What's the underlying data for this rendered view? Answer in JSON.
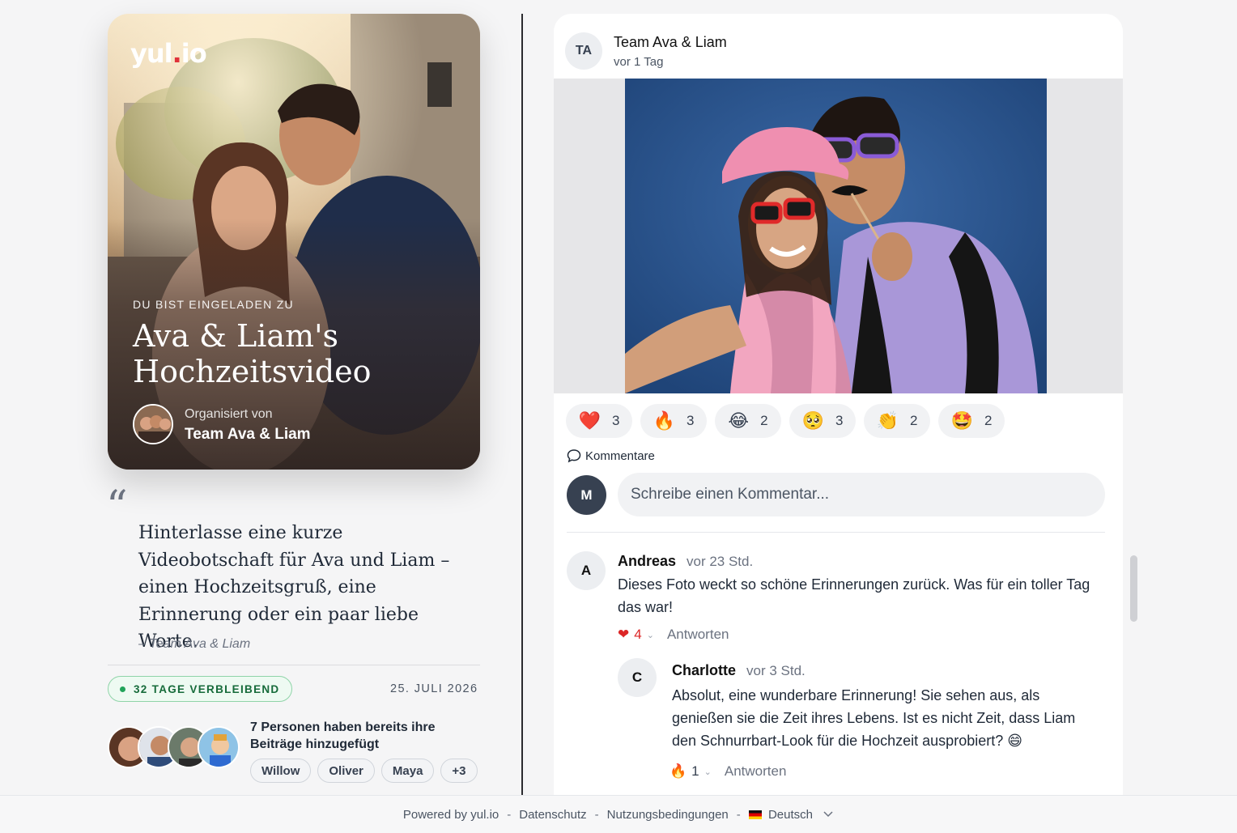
{
  "hero": {
    "logo_text": "yul",
    "logo_dot": ".",
    "logo_suffix": "io",
    "eyebrow": "DU BIST EINGELADEN ZU",
    "title_line1": "Ava & Liam's",
    "title_line2": "Hochzeitsvideo",
    "organizer_label": "Organisiert von",
    "organizer_name": "Team Ava & Liam"
  },
  "quote": {
    "mark": "“",
    "text": "Hinterlasse eine kurze Videobotschaft für Ava und Liam – einen Hochzeitsgruß, eine Erinnerung oder ein paar liebe Worte.",
    "signature": "– Team Ava & Liam"
  },
  "status": {
    "days_left": "32 TAGE VERBLEIBEND",
    "date": "25. JULI 2026",
    "status_color": "#22a35a"
  },
  "contributors": {
    "text": "7 Personen haben bereits ihre Beiträge hinzugefügt",
    "names": [
      "Willow",
      "Oliver",
      "Maya",
      "+3"
    ]
  },
  "post": {
    "author_initials": "TA",
    "author": "Team Ava & Liam",
    "time": "vor 1 Tag",
    "reactions": [
      {
        "icon": "heart-icon",
        "emoji": "❤️",
        "count": "3"
      },
      {
        "icon": "fire-icon",
        "emoji": "🔥",
        "count": "3"
      },
      {
        "icon": "laughing-icon",
        "emoji": "😂",
        "count": "2"
      },
      {
        "icon": "pleading-icon",
        "emoji": "🥺",
        "count": "3"
      },
      {
        "icon": "clapping-icon",
        "emoji": "👏",
        "count": "2"
      },
      {
        "icon": "star-struck-icon",
        "emoji": "🤩",
        "count": "2"
      }
    ],
    "comments_label": "Kommentare",
    "my_initial": "M",
    "comment_placeholder": "Schreibe einen Kommentar..."
  },
  "comments": [
    {
      "initial": "A",
      "name": "Andreas",
      "time": "vor 23 Std.",
      "text": "Dieses Foto weckt so schöne Erinnerungen zurück. Was für ein toller Tag das war!",
      "reaction_emoji": "❤",
      "reaction_count": "4",
      "reply_label": "Antworten"
    },
    {
      "initial": "C",
      "name": "Charlotte",
      "time": "vor 3 Std.",
      "text": "Absolut, eine wunderbare Erinnerung! Sie sehen aus, als genießen sie die Zeit ihres Lebens. Ist es nicht Zeit, dass Liam den Schnurrbart-Look für die Hochzeit ausprobiert? 😄",
      "reaction_emoji": "🔥",
      "reaction_count": "1",
      "reply_label": "Antworten"
    }
  ],
  "footer": {
    "powered": "Powered by yul.io",
    "sep": "-",
    "privacy": "Datenschutz",
    "terms": "Nutzungsbedingungen",
    "language": "Deutsch"
  },
  "colors": {
    "accent_red": "#e0323a",
    "dark": "#374151"
  }
}
